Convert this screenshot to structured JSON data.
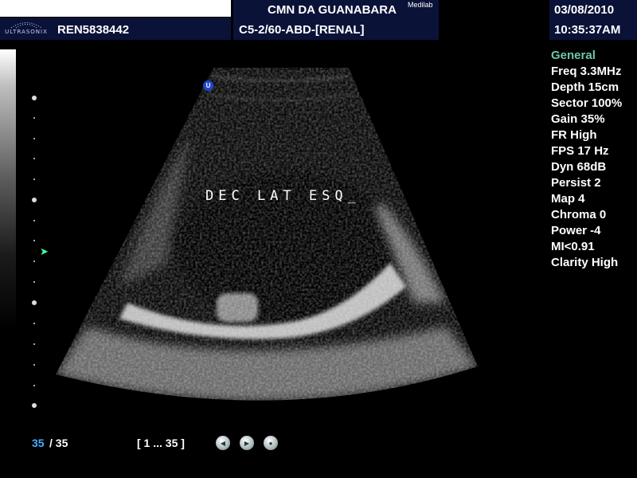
{
  "header": {
    "logo_text": "ULTRASONIX",
    "patient_id": "REN5838442",
    "institution": "CMN DA GUANABARA",
    "institution_sup": "Medilab",
    "preset": "C5-2/60-ABD-[RENAL]",
    "date": "03/08/2010",
    "time": "10:35:37AM"
  },
  "image": {
    "annotation": "DEC LAT ESQ_",
    "orientation_marker": "U"
  },
  "params": {
    "heading": "General",
    "items": [
      "Freq 3.3MHz",
      "Depth 15cm",
      "Sector 100%",
      "Gain 35%",
      "FR High",
      "FPS 17 Hz",
      "Dyn 68dB",
      "Persist 2",
      "Map 4",
      "Chroma 0",
      "Power -4",
      "MI<0.91",
      "Clarity High"
    ]
  },
  "playback": {
    "current_frame": "35",
    "total_frames": "/ 35",
    "range": "[ 1 ... 35 ]"
  },
  "colors": {
    "header_navy": "#0b1238",
    "param_heading": "#6fc7a6",
    "frame_current": "#4ab0ff"
  }
}
